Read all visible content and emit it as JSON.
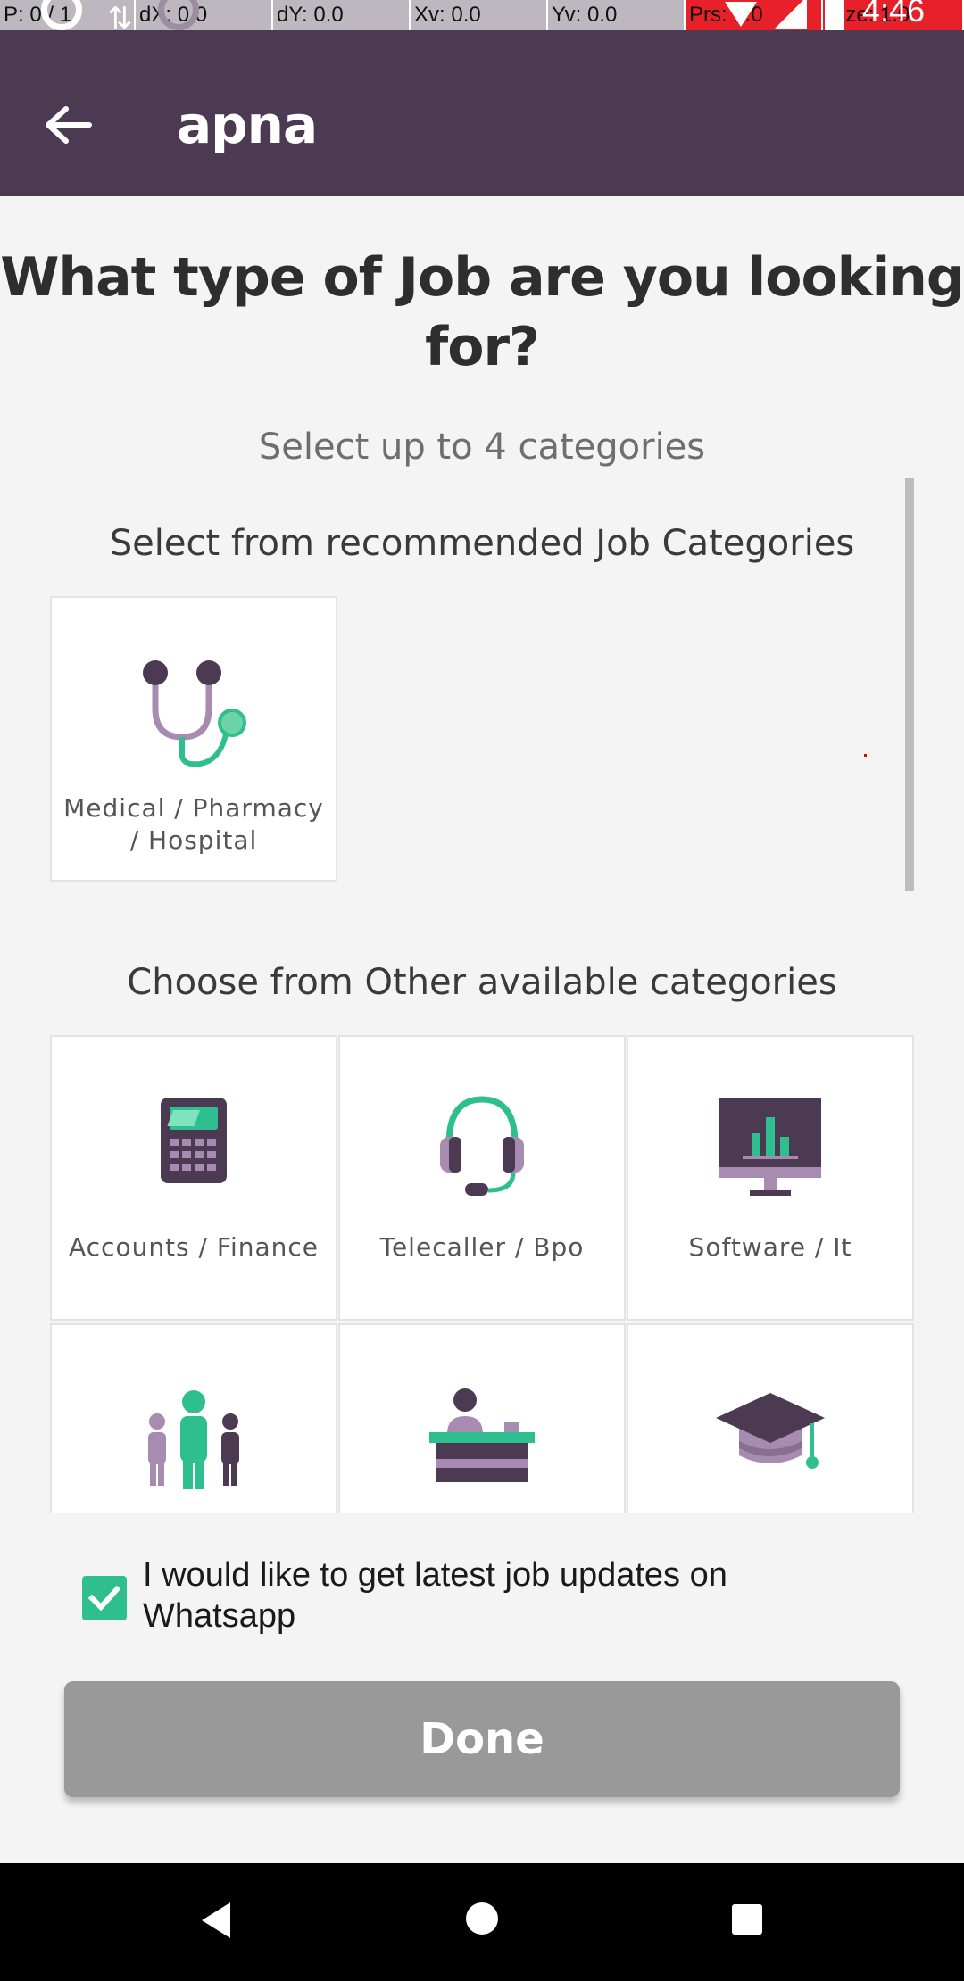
{
  "debug": {
    "cells": [
      "P: 0 / 1",
      "dX: 0.0",
      "dY: 0.0",
      "Xv: 0.0",
      "Yv: 0.0",
      "Prs: 1.0",
      "Size: 1.0"
    ]
  },
  "status_bar": {
    "time": "4:46"
  },
  "app_bar": {
    "title": "apna"
  },
  "page": {
    "title": "What type of Job are you looking for?",
    "subtitle": "Select up to 4 categories",
    "recommended_heading": "Select from recommended Job Categories",
    "other_heading": "Choose from Other available categories"
  },
  "recommended": [
    {
      "label": "Medical / Pharmacy / Hospital",
      "icon": "stethoscope-icon"
    }
  ],
  "categories": [
    {
      "label": "Accounts / Finance",
      "icon": "calculator-icon"
    },
    {
      "label": "Telecaller / Bpo",
      "icon": "headset-icon"
    },
    {
      "label": "Software / It",
      "icon": "monitor-chart-icon"
    },
    {
      "label": "",
      "icon": "people-icon"
    },
    {
      "label": "",
      "icon": "reception-desk-icon"
    },
    {
      "label": "",
      "icon": "graduation-cap-icon"
    }
  ],
  "whatsapp": {
    "label": "I would like to get latest job updates on Whatsapp",
    "checked": true
  },
  "done_button": {
    "label": "Done"
  },
  "colors": {
    "brand_purple": "#4c3a52",
    "accent_green": "#2fbf8e",
    "disabled_button": "#999999",
    "light_purple": "#a88bb0"
  }
}
